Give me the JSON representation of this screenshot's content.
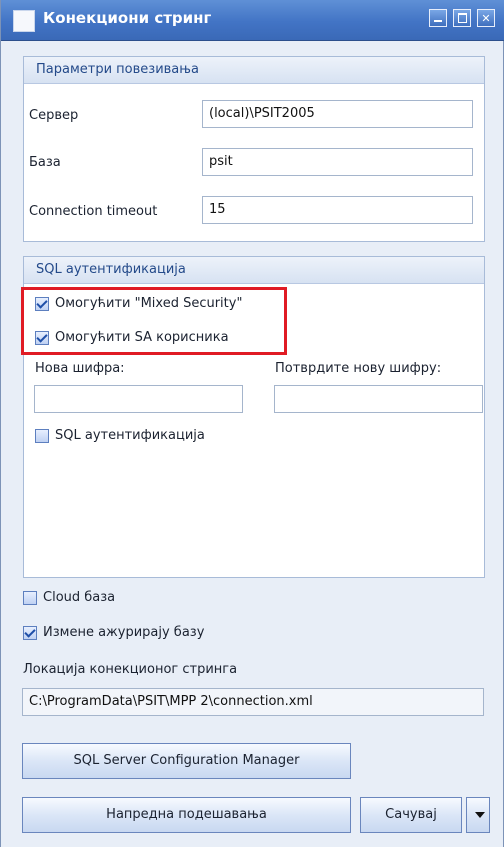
{
  "window": {
    "title": "Конекциони стринг"
  },
  "connection_group": {
    "title": "Параметри повезивања",
    "server_label": "Сервер",
    "server_value": "(local)\\PSIT2005",
    "database_label": "База",
    "database_value": "psit",
    "timeout_label": "Connection timeout",
    "timeout_value": "15"
  },
  "sql_group": {
    "title": "SQL аутентификација",
    "mixed_security_label": "Омогућити \"Mixed Security\"",
    "mixed_security_checked": true,
    "sa_user_label": "Омогућити SA корисника",
    "sa_user_checked": true,
    "new_password_label": "Нова шифра:",
    "new_password_value": "",
    "confirm_password_label": "Потврдите нову шифру:",
    "confirm_password_value": "",
    "sql_auth_checkbox_label": "SQL аутентификација",
    "sql_auth_checked": false
  },
  "options": {
    "cloud_label": "Cloud база",
    "cloud_checked": false,
    "updates_label": "Измене ажурирају базу",
    "updates_checked": true
  },
  "location": {
    "label": "Локација конекционог стринга",
    "value": "C:\\ProgramData\\PSIT\\MPP 2\\connection.xml"
  },
  "buttons": {
    "config_manager": "SQL Server Configuration Manager",
    "advanced_settings": "Напредна подешавања",
    "save": "Сачувај"
  },
  "colors": {
    "title_bar": "#4274c5",
    "window_bg": "#e8eef7",
    "group_header": "#d7e2f2",
    "highlight_border": "#e01b24"
  }
}
